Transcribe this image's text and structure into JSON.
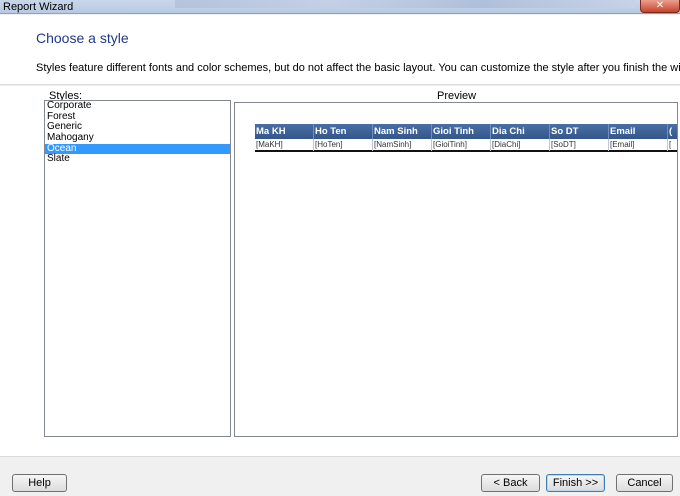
{
  "window": {
    "title": "Report Wizard",
    "close_glyph": "✕"
  },
  "header": {
    "heading": "Choose a style",
    "description": "Styles feature different fonts and color schemes, but do not affect the basic layout. You can customize the style after you finish the wizard."
  },
  "styles": {
    "label": "Styles:",
    "items": [
      "Corporate",
      "Forest",
      "Generic",
      "Mahogany",
      "Ocean",
      "Slate"
    ],
    "selected": "Ocean"
  },
  "preview": {
    "label": "Preview",
    "headers": [
      "Ma KH",
      "Ho Ten",
      "Nam Sinh",
      "Gioi Tinh",
      "Dia Chi",
      "So DT",
      "Email",
      "("
    ],
    "cells": [
      "[MaKH]",
      "[HoTen]",
      "[NamSinh]",
      "[GioiTinh]",
      "[DiaChi]",
      "[SoDT]",
      "[Email]",
      "["
    ],
    "header_color": "#34568a"
  },
  "footer": {
    "help": "Help",
    "back": "< Back",
    "finish": "Finish >>",
    "cancel": "Cancel"
  }
}
